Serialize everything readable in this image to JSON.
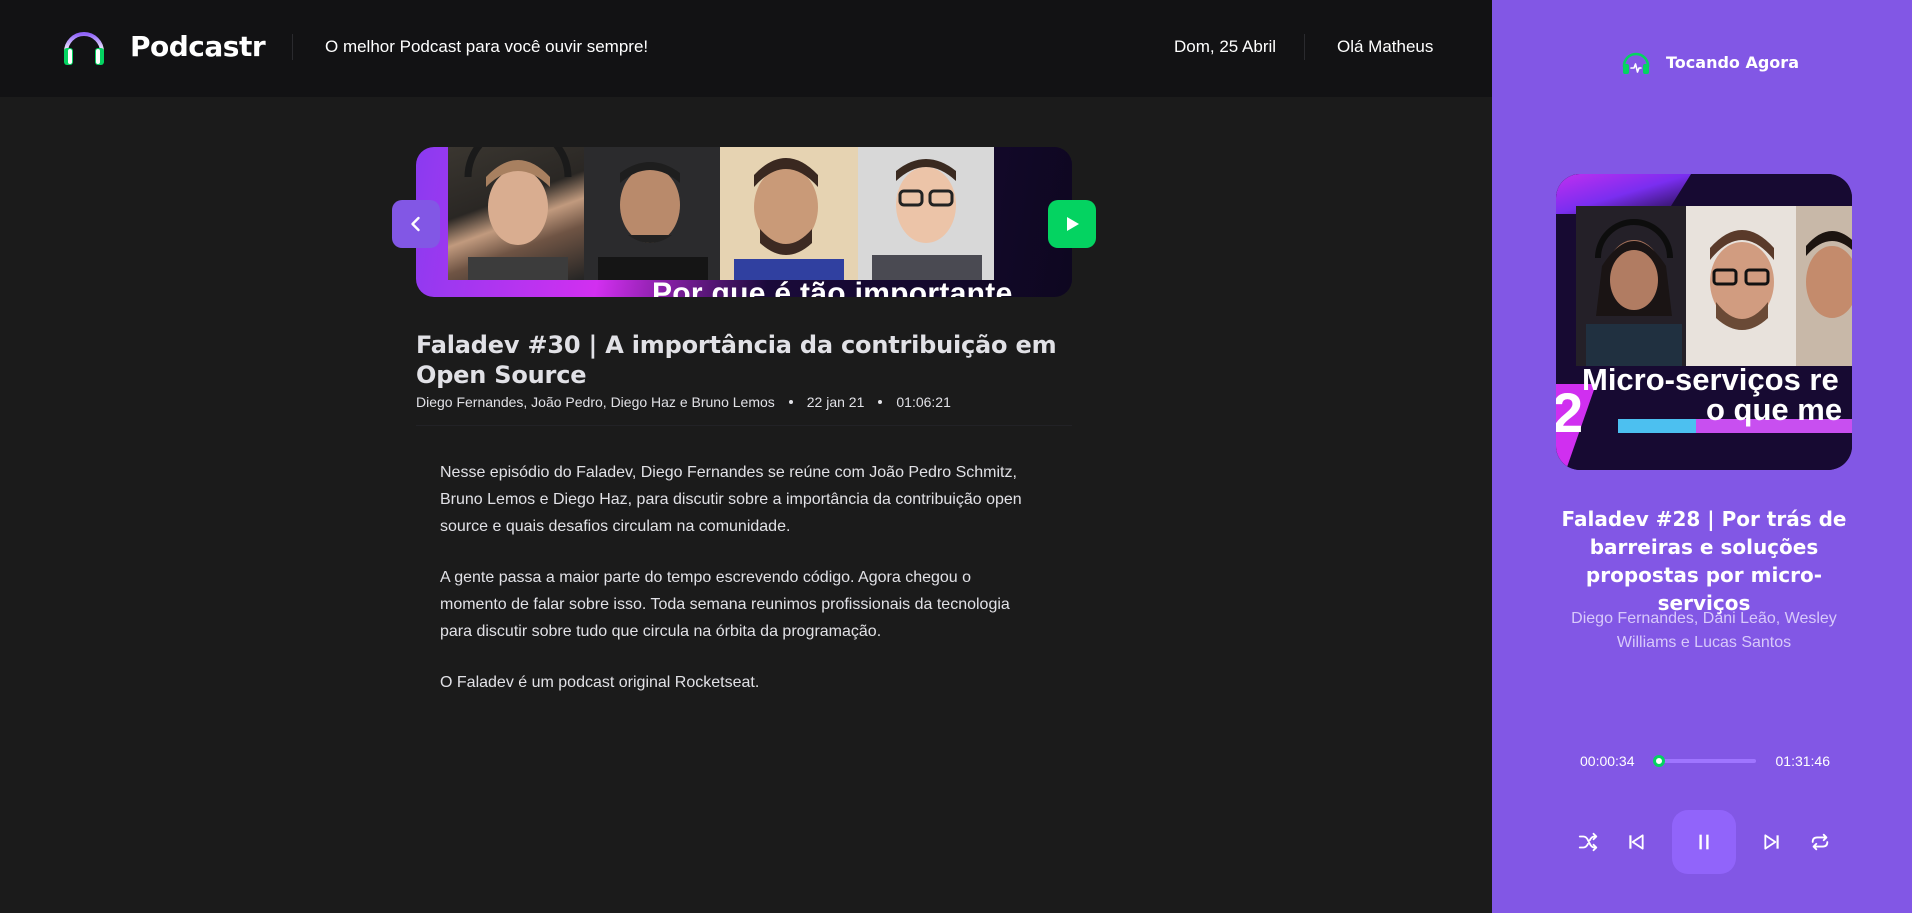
{
  "header": {
    "app_name": "Podcastr",
    "tagline": "O melhor Podcast para você ouvir sempre!",
    "date": "Dom, 25 Abril",
    "greeting": "Olá Matheus",
    "logo_icon": "headphones-icon"
  },
  "episode": {
    "thumbnail_caption": "Por que é tão importante",
    "title": "Faladev #30 | A importância da contribuição em Open Source",
    "members": "Diego Fernandes, João Pedro, Diego Haz e Bruno Lemos",
    "published_at": "22 jan 21",
    "duration": "01:06:21",
    "back_icon": "chevron-left-icon",
    "play_icon": "play-icon",
    "description": [
      "Nesse episódio do Faladev, Diego Fernandes se reúne com João Pedro Schmitz, Bruno Lemos e Diego Haz, para discutir sobre a importância da contribuição open source e quais desafios circulam na comunidade.",
      "A gente passa a maior parte do tempo escrevendo código. Agora chegou o momento de falar sobre isso. Toda semana reunimos profissionais da tecnologia para discutir sobre tudo que circula na órbita da programação.",
      "O Faladev é um podcast original Rocketseat."
    ]
  },
  "player": {
    "label": "Tocando Agora",
    "icon": "playing-headphones-icon",
    "cover_text_line1": "Micro-serviços re",
    "cover_text_line2": "o que me",
    "cover_number": "2",
    "title": "Faladev #28 | Por trás de barreiras e soluções propostas por micro-serviços",
    "members": "Diego Fernandes, Dani Leão, Wesley Williams e Lucas Santos",
    "current_time": "00:00:34",
    "total_time": "01:31:46",
    "progress": 0.006,
    "controls": [
      "shuffle-icon",
      "previous-icon",
      "pause-icon",
      "next-icon",
      "repeat-icon"
    ]
  },
  "colors": {
    "background": "#1b1b1b",
    "header_bg": "#121214",
    "purple": "#8257e5",
    "green": "#04d361"
  }
}
